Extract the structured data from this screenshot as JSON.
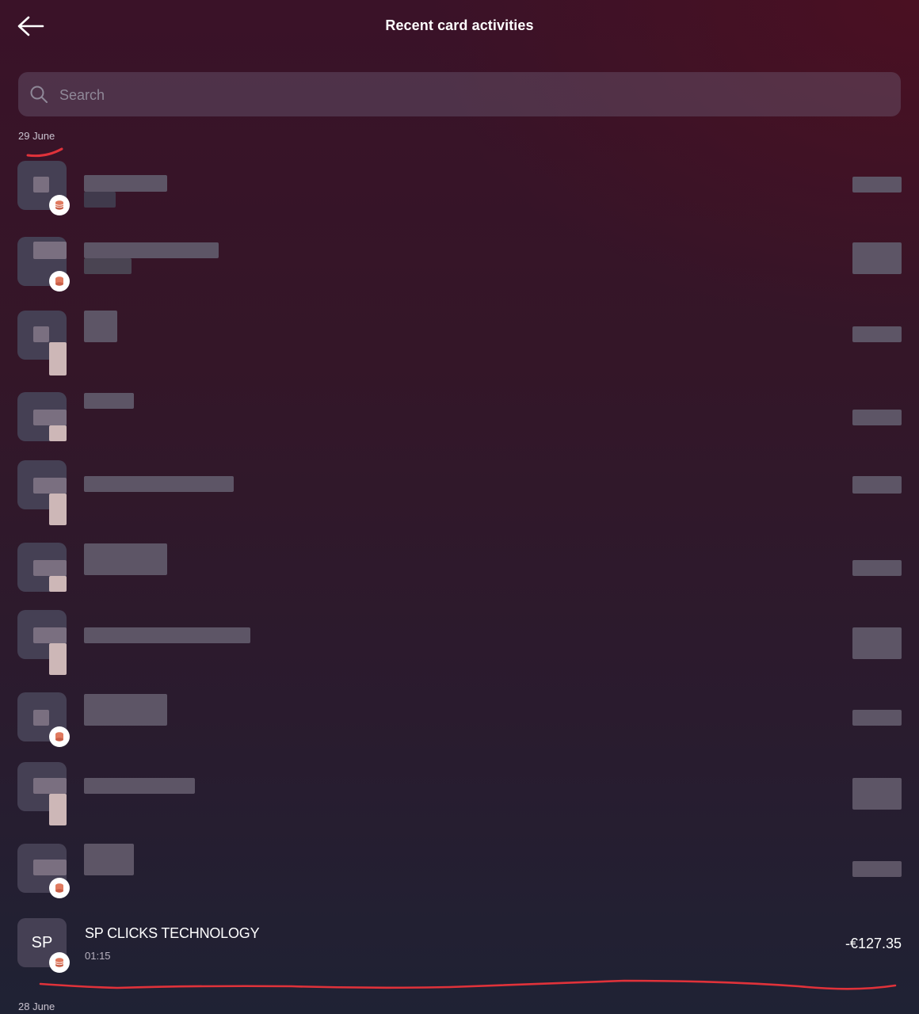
{
  "header": {
    "title": "Recent card activities",
    "back_icon": "arrow-left-icon"
  },
  "search": {
    "placeholder": "Search",
    "icon": "search-icon"
  },
  "groups": [
    {
      "date": "29 June",
      "transactions": [
        {
          "redacted": true
        },
        {
          "redacted": true
        },
        {
          "redacted": true
        },
        {
          "redacted": true
        },
        {
          "redacted": true
        },
        {
          "redacted": true
        },
        {
          "redacted": true
        },
        {
          "redacted": true
        },
        {
          "redacted": true
        },
        {
          "redacted": true
        },
        {
          "redacted": false,
          "avatar_initials": "SP",
          "merchant": "SP CLICKS TECHNOLOGY",
          "time": "01:15",
          "amount": "-€127.35",
          "badge_icon": "coin-stack-icon"
        }
      ]
    },
    {
      "date": "28 June",
      "transactions": []
    }
  ],
  "colors": {
    "annotation_red": "#e0323a",
    "avatar_bg": "#454054",
    "badge_coin": "#e07a5f"
  }
}
